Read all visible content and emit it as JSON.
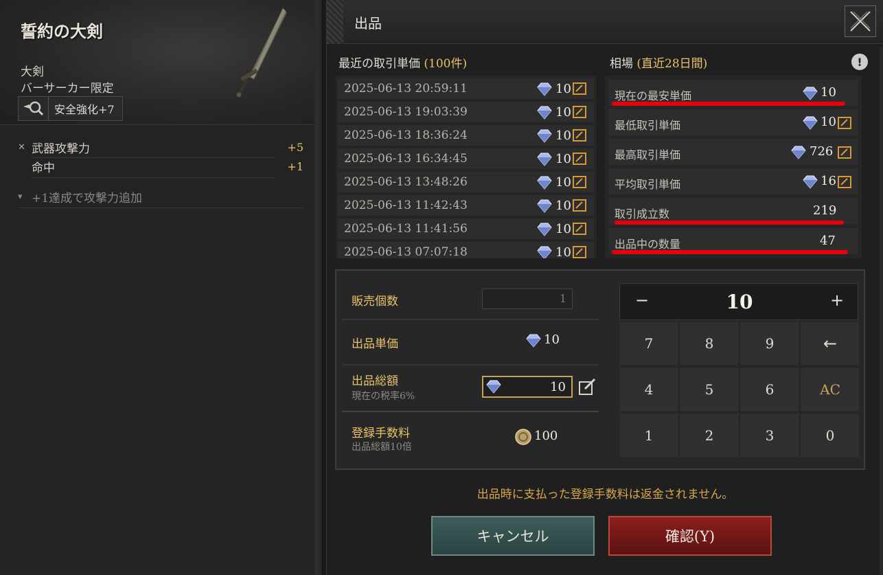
{
  "item": {
    "name": "誓約の大剣",
    "type": "大剣",
    "class_limit": "バーサーカー限定",
    "enhancement": "安全強化+7",
    "stats": [
      {
        "label": "武器攻撃力",
        "value": "+5"
      },
      {
        "label": "命中",
        "value": "+1"
      }
    ],
    "bonus": "+1達成で攻撃力追加"
  },
  "dialog": {
    "title": "出品",
    "recent": {
      "title": "最近の取引単価",
      "count": "(100件)",
      "rows": [
        {
          "datetime": "2025-06-13 20:59:11",
          "price": "10"
        },
        {
          "datetime": "2025-06-13 19:03:39",
          "price": "10"
        },
        {
          "datetime": "2025-06-13 18:36:24",
          "price": "10"
        },
        {
          "datetime": "2025-06-13 16:34:45",
          "price": "10"
        },
        {
          "datetime": "2025-06-13 13:48:26",
          "price": "10"
        },
        {
          "datetime": "2025-06-13 11:42:43",
          "price": "10"
        },
        {
          "datetime": "2025-06-13 11:41:56",
          "price": "10"
        },
        {
          "datetime": "2025-06-13 07:07:18",
          "price": "10"
        }
      ]
    },
    "market": {
      "title": "相場",
      "period": "(直近28日間)",
      "rows": [
        {
          "label": "現在の最安単価",
          "value": "10"
        },
        {
          "label": "最低取引単価",
          "value": "10"
        },
        {
          "label": "最高取引単価",
          "value": "726"
        },
        {
          "label": "平均取引単価",
          "value": "16"
        },
        {
          "label": "取引成立数",
          "value": "219"
        },
        {
          "label": "出品中の数量",
          "value": "47"
        }
      ]
    },
    "sell": {
      "qty_label": "販売個数",
      "qty_value": "1",
      "unit_label": "出品単価",
      "unit_value": "10",
      "total_label": "出品総額",
      "tax_note": "現在の税率6%",
      "total_value": "10",
      "fee_label": "登録手数料",
      "fee_note": "出品総額10倍",
      "fee_value": "100"
    },
    "keypad": {
      "minus": "−",
      "plus": "+",
      "value": "10",
      "keys": [
        "7",
        "8",
        "9",
        "←",
        "4",
        "5",
        "6",
        "AC",
        "1",
        "2",
        "3",
        "0"
      ]
    },
    "warning": "出品時に支払った登録手数料は返金されません。",
    "cancel_label": "キャンセル",
    "confirm_label": "確認(Y)"
  },
  "colors": {
    "accent_gold": "#e8c36a",
    "highlight_red": "#e8000a",
    "cancel_teal": "#3d5d5a",
    "confirm_red": "#8a1f1f"
  }
}
